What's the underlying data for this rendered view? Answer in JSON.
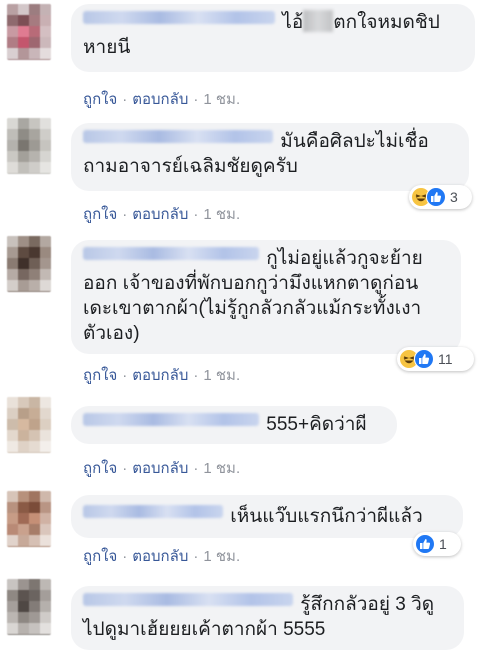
{
  "actions": {
    "like_label": "ถูกใจ",
    "reply_label": "ตอบกลับ",
    "separator": "·",
    "time": "1 ชม."
  },
  "comments": [
    {
      "text_line1": "ไอ้",
      "text_line1_after_mask": "ตกใจหมดชิป",
      "text_line2": "หายนี",
      "reaction_count": ""
    },
    {
      "text_line1": "มันคือศิลปะไม่เชื่อ",
      "text_line2": "ถามอาจารย์เฉลิมชัยดูครับ",
      "reaction_count": "3"
    },
    {
      "text_line1": "กูไม่อยู่แล้วกูจะย้าย",
      "text_line2": "ออก เจ้าของที่พักบอกกูว่ามึงแหกตาดูก่อน",
      "text_line3": "เดะเขาตากผ้า(ไม่รู้กูกลัวกลัวแม้กระทั้งเงา",
      "text_line4": "ตัวเอง)",
      "reaction_count": "11"
    },
    {
      "text_line1": "555+คิดว่าผี",
      "reaction_count": ""
    },
    {
      "text_line1": "เห็นแว๊บแรกนึกว่าผีแล้ว",
      "reaction_count": "1"
    },
    {
      "text_line1": "รู้สึกกลัวอยู่ 3 วิดู",
      "text_line2": "ไปดูมาเฮ้ยยยเค้าตากผ้า 5555",
      "reaction_count": ""
    }
  ],
  "colors": {
    "bubble": "#f2f3f5",
    "link": "#385898",
    "muted": "#90949c",
    "like_blue": "#2078f4",
    "haha_yellow": "#f7c442"
  },
  "icons": [
    "haha-reaction-icon",
    "like-reaction-icon"
  ]
}
